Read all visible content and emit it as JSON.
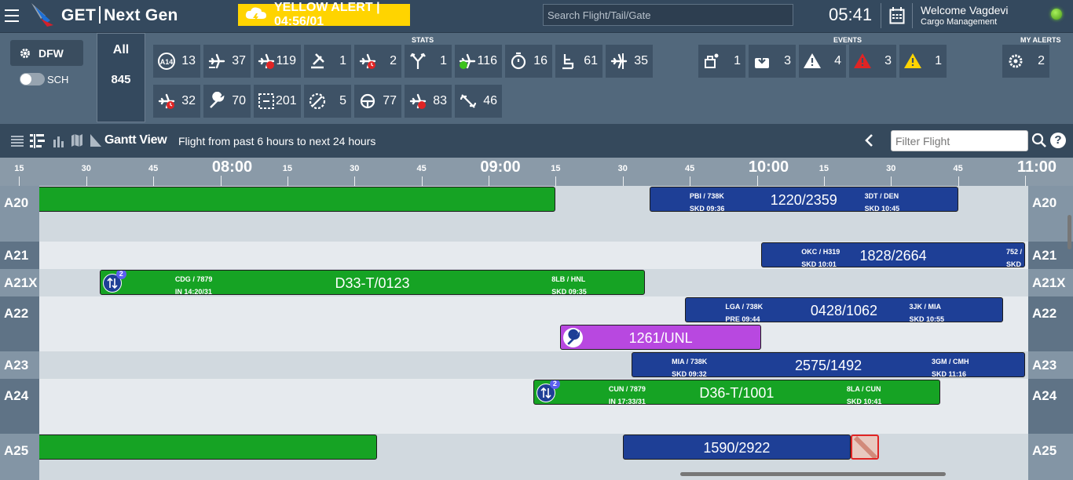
{
  "app": {
    "title": "GET",
    "subtitle": "Next Gen"
  },
  "alert": {
    "text": "YELLOW ALERT | 04:56/01",
    "color": "#ffd400"
  },
  "search": {
    "placeholder": "Search Flight/Tail/Gate"
  },
  "clock": "05:41",
  "user": {
    "welcome": "Welcome Vagdevi",
    "role": "Cargo Management",
    "status_color": "#7bd12c"
  },
  "station": {
    "code": "DFW",
    "sch_label": "SCH",
    "sch_on": false
  },
  "all": {
    "label": "All",
    "count": "845"
  },
  "sections": {
    "stats": "STATS",
    "events": "EVENTS",
    "my_alerts": "MY ALERTS"
  },
  "stats": [
    {
      "icon": "a14-circle-icon",
      "value": "13"
    },
    {
      "icon": "aircraft-tow-icon",
      "value": "37"
    },
    {
      "icon": "aircraft-alert-icon",
      "value": "119"
    },
    {
      "icon": "gavel-icon",
      "value": "1"
    },
    {
      "icon": "aircraft-delay-icon",
      "value": "2"
    },
    {
      "icon": "fork-arrow-icon",
      "value": "1"
    },
    {
      "icon": "aircraft-ontime-icon",
      "value": "116"
    },
    {
      "icon": "stopwatch-icon",
      "value": "16"
    },
    {
      "icon": "seat-icon",
      "value": "61"
    },
    {
      "icon": "aircraft-arrow-icon",
      "value": "35"
    },
    {
      "icon": "aircraft-late-icon",
      "value": "32"
    },
    {
      "icon": "wrench-icon",
      "value": "70"
    },
    {
      "icon": "dashed-box-icon",
      "value": "201"
    },
    {
      "icon": "no-entry-icon",
      "value": "5"
    },
    {
      "icon": "steering-icon",
      "value": "77"
    },
    {
      "icon": "aircraft-stop-icon",
      "value": "83"
    },
    {
      "icon": "broken-link-icon",
      "value": "46"
    }
  ],
  "events": [
    {
      "icon": "baggage-people-icon",
      "value": "1"
    },
    {
      "icon": "luggage-down-icon",
      "value": "3"
    },
    {
      "icon": "warning-white-icon",
      "value": "4"
    },
    {
      "icon": "warning-red-icon",
      "value": "3"
    },
    {
      "icon": "warning-yellow-icon",
      "value": "1"
    }
  ],
  "my_alerts": [
    {
      "icon": "gear-alert-icon",
      "value": "2"
    }
  ],
  "gantt": {
    "view_label": "Gantt View",
    "range_text": "Flight from past 6 hours to next 24 hours",
    "filter_placeholder": "Filter Flight",
    "help": "?"
  },
  "timeline": {
    "ticks": [
      "15",
      "30",
      "45",
      "08:00",
      "15",
      "30",
      "45",
      "09:00",
      "15",
      "30",
      "45",
      "10:00",
      "15",
      "30",
      "45",
      "11:00"
    ],
    "hour_labels": [
      "08:00",
      "09:00",
      "10:00",
      "11:00"
    ]
  },
  "gates": [
    {
      "name": "A20"
    },
    {
      "name": "A21"
    },
    {
      "name": "A21X"
    },
    {
      "name": "A22"
    },
    {
      "name": "A23"
    },
    {
      "name": "A24"
    },
    {
      "name": "A25"
    }
  ],
  "flights": [
    {
      "gate": "A20",
      "label": "",
      "color": "green",
      "in": "07:19",
      "out": "09:15"
    },
    {
      "gate": "A20",
      "label": "1220/2359",
      "color": "blue",
      "in": "09:36",
      "out": "10:45",
      "left_top": "PBI /  738K",
      "left_bot": "SKD  09:36",
      "right_top": "3DT /  DEN",
      "right_bot": "SKD  10:45"
    },
    {
      "gate": "A21",
      "label": "1828/2664",
      "color": "blue",
      "in": "10:01",
      "out": "11:00",
      "left_top": "OKC /  H319",
      "left_bot": "SKD  10:01",
      "right_top": "752 /",
      "right_bot": "SKD"
    },
    {
      "gate": "A21X",
      "label": "D33-T/0123",
      "color": "green",
      "in": "07:33",
      "out": "09:35",
      "left_top": "CDG /  7879",
      "left_bot": "IN  14:20/31",
      "right_top": "8LB /  HNL",
      "right_bot": "SKD  09:35",
      "badge": "2"
    },
    {
      "gate": "A22",
      "label": "0428/1062",
      "color": "blue",
      "in": "09:44",
      "out": "10:55",
      "left_top": "LGA /  738K",
      "left_bot": "PRE  09:44",
      "right_top": "3JK /  MIA",
      "right_bot": "SKD  10:55"
    },
    {
      "gate": "A22",
      "label": "1261/UNL",
      "color": "purple",
      "in": "09:16",
      "out": "10:01",
      "wrench": true
    },
    {
      "gate": "A23",
      "label": "2575/1492",
      "color": "blue",
      "in": "09:32",
      "out": "11:00",
      "left_top": "MIA /  738K",
      "left_bot": "SKD  09:32",
      "right_top": "3GM /  CMH",
      "right_bot": "SKD  11:16"
    },
    {
      "gate": "A24",
      "label": "D36-T/1001",
      "color": "green",
      "in": "09:10",
      "out": "10:41",
      "left_top": "CUN /  7879",
      "left_bot": "IN  17:33/31",
      "right_top": "8LA /  CUN",
      "right_bot": "SKD  10:41",
      "badge": "2"
    },
    {
      "gate": "A25",
      "label": "",
      "color": "green",
      "in": "07:19",
      "out": "08:35"
    },
    {
      "gate": "A25",
      "label": "1590/2922",
      "color": "blue",
      "in": "09:30",
      "out": "10:21",
      "cancelled_tail": true
    }
  ]
}
